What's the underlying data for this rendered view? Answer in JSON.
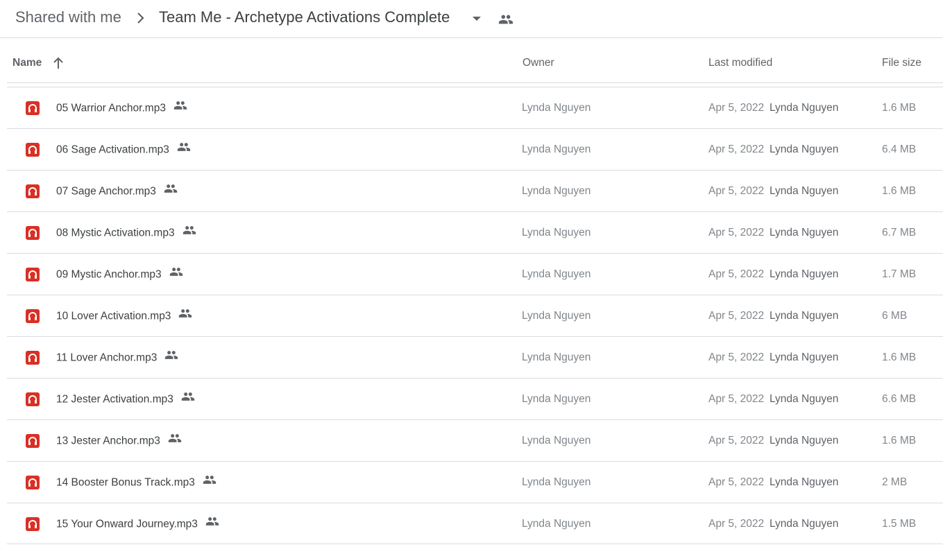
{
  "breadcrumb": {
    "root": "Shared with me",
    "current": "Team Me - Archetype Activations Complete"
  },
  "columns": {
    "name": "Name",
    "owner": "Owner",
    "modified": "Last modified",
    "size": "File size"
  },
  "colors": {
    "audio_icon": "#d93025",
    "divider": "#dadce0",
    "muted_text": "#80868b"
  },
  "icons": {
    "breadcrumb_separator": "chevron-right-icon",
    "folder_menu": "caret-down-icon",
    "shared": "people-icon",
    "sort": "arrow-up-icon",
    "file_type": "headphones-audio-icon"
  },
  "files": [
    {
      "name": "05 Warrior Anchor.mp3",
      "owner": "Lynda Nguyen",
      "date": "Apr 5, 2022",
      "modified_by": "Lynda Nguyen",
      "size": "1.6 MB"
    },
    {
      "name": "06 Sage Activation.mp3",
      "owner": "Lynda Nguyen",
      "date": "Apr 5, 2022",
      "modified_by": "Lynda Nguyen",
      "size": "6.4 MB"
    },
    {
      "name": "07 Sage Anchor.mp3",
      "owner": "Lynda Nguyen",
      "date": "Apr 5, 2022",
      "modified_by": "Lynda Nguyen",
      "size": "1.6 MB"
    },
    {
      "name": "08 Mystic Activation.mp3",
      "owner": "Lynda Nguyen",
      "date": "Apr 5, 2022",
      "modified_by": "Lynda Nguyen",
      "size": "6.7 MB"
    },
    {
      "name": "09 Mystic Anchor.mp3",
      "owner": "Lynda Nguyen",
      "date": "Apr 5, 2022",
      "modified_by": "Lynda Nguyen",
      "size": "1.7 MB"
    },
    {
      "name": "10 Lover Activation.mp3",
      "owner": "Lynda Nguyen",
      "date": "Apr 5, 2022",
      "modified_by": "Lynda Nguyen",
      "size": "6 MB"
    },
    {
      "name": "11 Lover Anchor.mp3",
      "owner": "Lynda Nguyen",
      "date": "Apr 5, 2022",
      "modified_by": "Lynda Nguyen",
      "size": "1.6 MB"
    },
    {
      "name": "12 Jester Activation.mp3",
      "owner": "Lynda Nguyen",
      "date": "Apr 5, 2022",
      "modified_by": "Lynda Nguyen",
      "size": "6.6 MB"
    },
    {
      "name": "13 Jester Anchor.mp3",
      "owner": "Lynda Nguyen",
      "date": "Apr 5, 2022",
      "modified_by": "Lynda Nguyen",
      "size": "1.6 MB"
    },
    {
      "name": "14 Booster Bonus Track.mp3",
      "owner": "Lynda Nguyen",
      "date": "Apr 5, 2022",
      "modified_by": "Lynda Nguyen",
      "size": "2 MB"
    },
    {
      "name": "15 Your Onward Journey.mp3",
      "owner": "Lynda Nguyen",
      "date": "Apr 5, 2022",
      "modified_by": "Lynda Nguyen",
      "size": "1.5 MB"
    }
  ]
}
